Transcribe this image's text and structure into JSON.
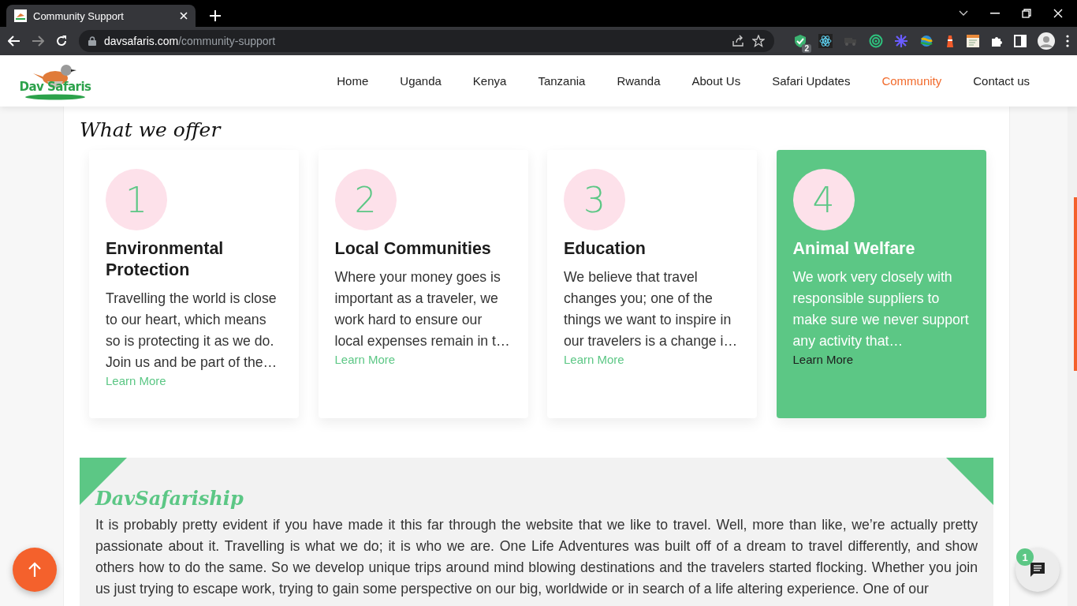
{
  "browser": {
    "tab_title": "Community Support",
    "url_host": "davsafaris.com",
    "url_path": "/community-support",
    "extension_badge": "2"
  },
  "site": {
    "logo_text": "Dav Safaris",
    "nav": [
      {
        "label": "Home",
        "selected": false
      },
      {
        "label": "Uganda",
        "selected": false
      },
      {
        "label": "Kenya",
        "selected": false
      },
      {
        "label": "Tanzania",
        "selected": false
      },
      {
        "label": "Rwanda",
        "selected": false
      },
      {
        "label": "About Us",
        "selected": false
      },
      {
        "label": "Safari Updates",
        "selected": false
      },
      {
        "label": "Community",
        "selected": true
      },
      {
        "label": "Contact us",
        "selected": false
      }
    ]
  },
  "offer": {
    "heading": "What we offer",
    "cards": [
      {
        "number": "1",
        "title": "Environmental Protection",
        "text": "Travelling the world is close to our heart, which means so is protecting it as we do. Join us and be part of the…",
        "link": "Learn More",
        "highlighted": false
      },
      {
        "number": "2",
        "title": "Local Communities",
        "text": "Where your money goes is important as a traveler, we work hard to ensure our local expenses remain in t…",
        "link": "Learn More",
        "highlighted": false
      },
      {
        "number": "3",
        "title": "Education",
        "text": "We believe that travel changes you; one of the things we want to inspire in our travelers is a change i…",
        "link": "Learn More",
        "highlighted": false
      },
      {
        "number": "4",
        "title": "Animal Welfare",
        "text": "We work very closely with responsible suppliers to make sure we never support any activity that…",
        "link": "Learn More",
        "highlighted": true
      }
    ]
  },
  "safariship": {
    "title": "DavSafariship",
    "text": "It is probably pretty evident if you have made it this far through the website that we like to travel. Well, more than like, we’re actually pretty passionate about it. Travelling is what we do; it is who we are. One Life Adventures was built off of a dream to travel differently, and show others how to do the same. So we develop unique trips around mind blowing destinations and the travelers started flocking. Whether you join us just trying to escape work, trying to gain some perspective on our big, worldwide or in search of a life altering experience. One of our"
  },
  "chat": {
    "badge": "1"
  }
}
